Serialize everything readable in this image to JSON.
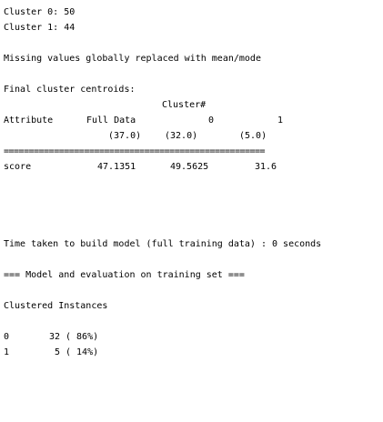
{
  "output": {
    "cluster_counts": [
      "Cluster 0: 50",
      "Cluster 1: 44"
    ],
    "missing_values_note": "Missing values globally replaced with mean/mode",
    "centroids_heading": "Final cluster centroids:",
    "table": {
      "cluster_header": "Cluster#",
      "attribute_header": "Attribute",
      "full_data_header": "Full Data",
      "cluster_ids": [
        "0",
        "1"
      ],
      "full_data_count": "(37.0)",
      "cluster_sizes": [
        "(32.0)",
        "(5.0)"
      ],
      "separator": "====================================================",
      "rows": [
        {
          "attribute": "score",
          "full_data": "47.1351",
          "clusters": [
            "49.5625",
            "31.6"
          ]
        }
      ]
    },
    "time_taken": "Time taken to build model (full training data) : 0 seconds",
    "evaluation_heading": "=== Model and evaluation on training set ===",
    "clustered_instances_heading": "Clustered Instances",
    "clustered_instances": [
      {
        "cluster": "0",
        "count": "32",
        "percent": "( 86%)"
      },
      {
        "cluster": "1",
        "count": " 5",
        "percent": "( 14%)"
      }
    ]
  }
}
